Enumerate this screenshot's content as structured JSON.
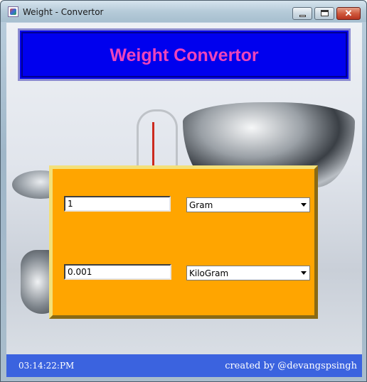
{
  "window": {
    "title": "Weight - Convertor"
  },
  "header": {
    "title": "Weight Convertor"
  },
  "converter": {
    "input_value": "1",
    "input_unit": "Gram",
    "output_value": "0.001",
    "output_unit": "KiloGram"
  },
  "status": {
    "time": "03:14:22:PM",
    "credit": "created by @devangspsingh"
  },
  "colors": {
    "header_bg": "#0000ee",
    "heading_text": "#ee44bb",
    "panel_bg": "#ffa500",
    "status_bg": "#3b63df"
  },
  "icons": [
    "app-icon",
    "minimize-icon",
    "maximize-icon",
    "close-icon",
    "dropdown-arrow-icon"
  ]
}
